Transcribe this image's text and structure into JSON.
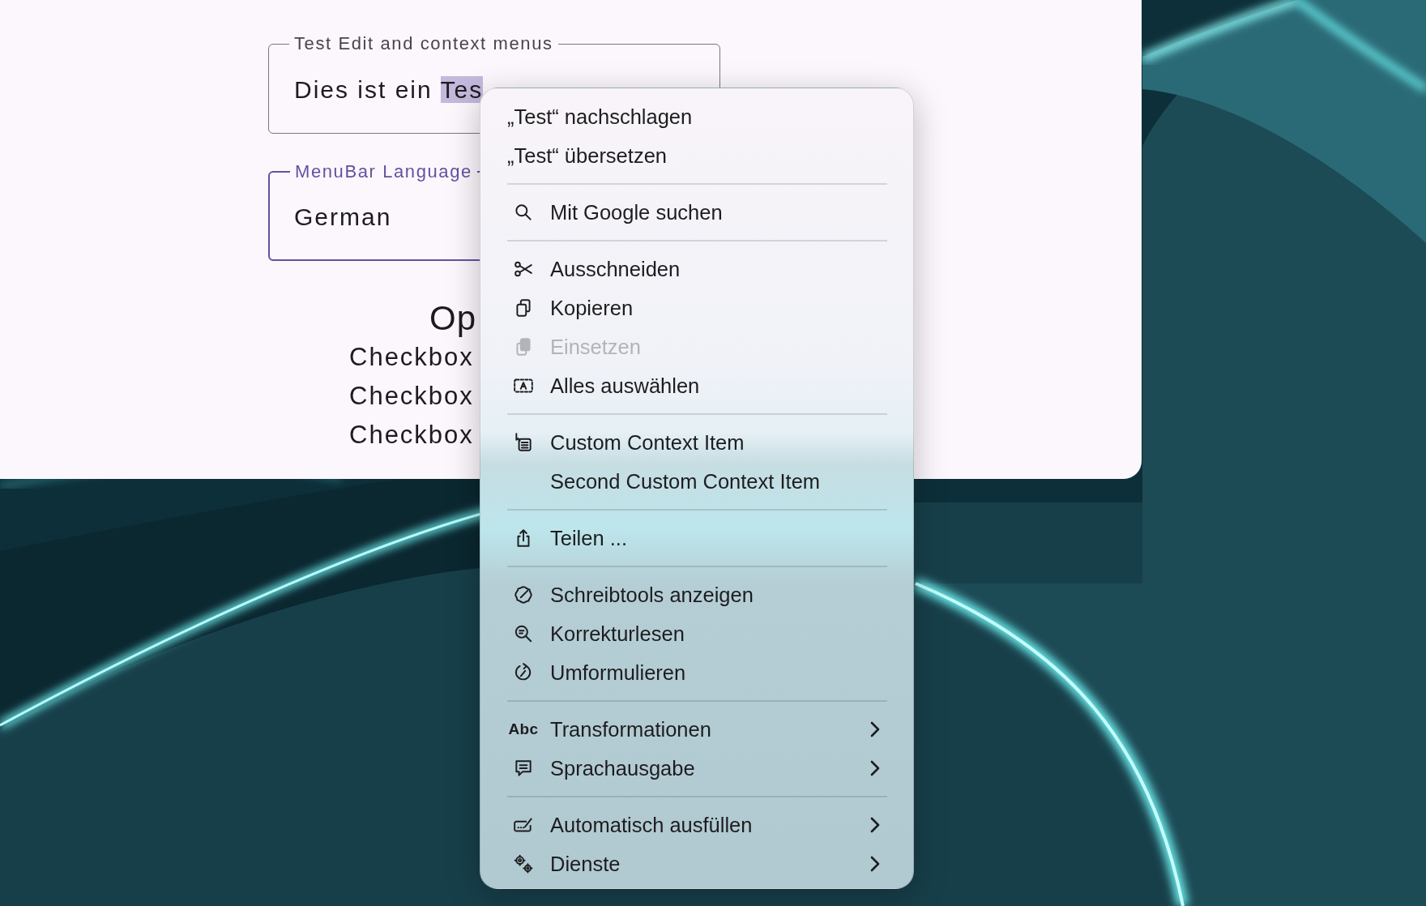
{
  "window": {
    "fields": [
      {
        "label": "Test Edit and context menus",
        "value": "Dies ist ein ",
        "selection": "Tes",
        "focused": false
      },
      {
        "label": "MenuBar Language",
        "value": "German",
        "focused": true
      }
    ],
    "options": {
      "heading": "Op",
      "checkboxes": [
        "Checkbox",
        "Checkbox",
        "Checkbox"
      ]
    }
  },
  "context_menu": {
    "groups": [
      {
        "items": [
          {
            "kind": "plain",
            "label": "„Test“ nachschlagen",
            "disabled": false,
            "submenu": false
          },
          {
            "kind": "plain",
            "label": "„Test“ übersetzen",
            "disabled": false,
            "submenu": false
          }
        ]
      },
      {
        "items": [
          {
            "kind": "command",
            "label": "Mit Google suchen",
            "disabled": false,
            "submenu": false
          }
        ]
      },
      {
        "items": [
          {
            "kind": "command",
            "label": "Ausschneiden",
            "disabled": false,
            "submenu": false
          },
          {
            "kind": "command",
            "label": "Kopieren",
            "disabled": false,
            "submenu": false
          },
          {
            "kind": "command",
            "label": "Einsetzen",
            "disabled": true,
            "submenu": false
          },
          {
            "kind": "command",
            "label": "Alles auswählen",
            "disabled": false,
            "submenu": false
          }
        ]
      },
      {
        "items": [
          {
            "kind": "command",
            "label": "Custom Context Item",
            "disabled": false,
            "submenu": false
          },
          {
            "kind": "command",
            "label": "Second Custom Context Item",
            "disabled": false,
            "submenu": false
          }
        ]
      },
      {
        "items": [
          {
            "kind": "command",
            "label": "Teilen ...",
            "disabled": false,
            "submenu": false
          }
        ]
      },
      {
        "items": [
          {
            "kind": "command",
            "label": "Schreibtools anzeigen",
            "disabled": false,
            "submenu": false
          },
          {
            "kind": "command",
            "label": "Korrekturlesen",
            "disabled": false,
            "submenu": false
          },
          {
            "kind": "command",
            "label": "Umformulieren",
            "disabled": false,
            "submenu": false
          }
        ]
      },
      {
        "items": [
          {
            "kind": "command",
            "icon_text": "Abc",
            "label": "Transformationen",
            "disabled": false,
            "submenu": true
          },
          {
            "kind": "command",
            "label": "Sprachausgabe",
            "disabled": false,
            "submenu": true
          }
        ]
      },
      {
        "items": [
          {
            "kind": "command",
            "label": "Automatisch ausfüllen",
            "disabled": false,
            "submenu": true
          },
          {
            "kind": "command",
            "label": "Dienste",
            "disabled": false,
            "submenu": true
          }
        ]
      }
    ]
  }
}
